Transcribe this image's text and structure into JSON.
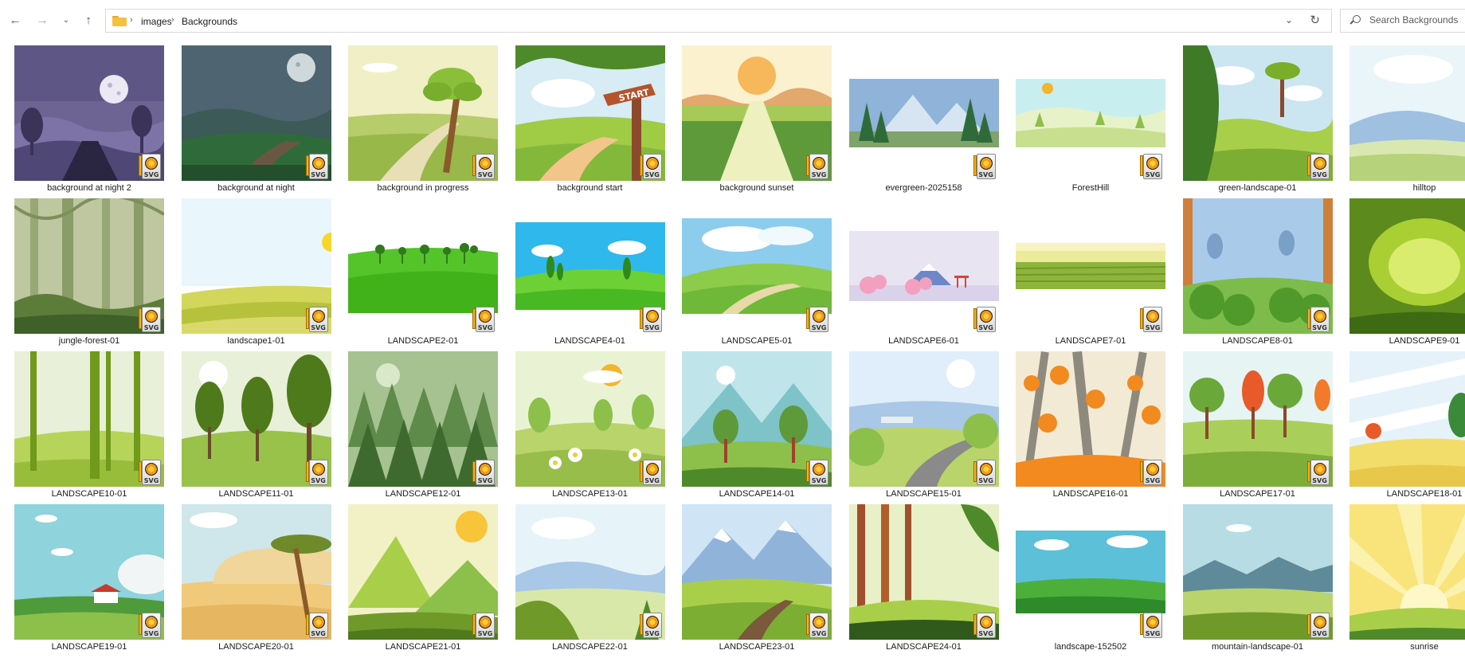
{
  "nav": {
    "back_icon": "arrow-left-icon",
    "forward_icon": "arrow-right-icon",
    "recent_icon": "chevron-down-icon",
    "up_icon": "arrow-up-icon"
  },
  "address": {
    "crumbs": [
      "images",
      "Backgrounds"
    ],
    "folder_icon": "folder-icon"
  },
  "search": {
    "placeholder": "Search Backgrounds"
  },
  "colors": {
    "folder": "#f6c03f",
    "svg_badge_orange": "#f39a13"
  },
  "files": [
    {
      "name": "background at night 2",
      "theme": "night2"
    },
    {
      "name": "background at night",
      "theme": "night"
    },
    {
      "name": "background in progress",
      "theme": "progress"
    },
    {
      "name": "background start",
      "theme": "start"
    },
    {
      "name": "background sunset",
      "theme": "sunset"
    },
    {
      "name": "evergreen-2025158",
      "theme": "evergreen"
    },
    {
      "name": "ForestHill",
      "theme": "foresthill"
    },
    {
      "name": "green-landscape-01",
      "theme": "greenland"
    },
    {
      "name": "hilltop",
      "theme": "hilltop"
    },
    {
      "name": "jungle-forest-01",
      "theme": "jungle"
    },
    {
      "name": "landscape1-01",
      "theme": "ls1"
    },
    {
      "name": "LANDSCAPE2-01",
      "theme": "ls2"
    },
    {
      "name": "LANDSCAPE4-01",
      "theme": "ls4"
    },
    {
      "name": "LANDSCAPE5-01",
      "theme": "ls5"
    },
    {
      "name": "LANDSCAPE6-01",
      "theme": "ls6"
    },
    {
      "name": "LANDSCAPE7-01",
      "theme": "ls7"
    },
    {
      "name": "LANDSCAPE8-01",
      "theme": "ls8"
    },
    {
      "name": "LANDSCAPE9-01",
      "theme": "ls9"
    },
    {
      "name": "LANDSCAPE10-01",
      "theme": "ls10"
    },
    {
      "name": "LANDSCAPE11-01",
      "theme": "ls11"
    },
    {
      "name": "LANDSCAPE12-01",
      "theme": "ls12"
    },
    {
      "name": "LANDSCAPE13-01",
      "theme": "ls13"
    },
    {
      "name": "LANDSCAPE14-01",
      "theme": "ls14"
    },
    {
      "name": "LANDSCAPE15-01",
      "theme": "ls15"
    },
    {
      "name": "LANDSCAPE16-01",
      "theme": "ls16"
    },
    {
      "name": "LANDSCAPE17-01",
      "theme": "ls17"
    },
    {
      "name": "LANDSCAPE18-01",
      "theme": "ls18"
    },
    {
      "name": "LANDSCAPE19-01",
      "theme": "ls19"
    },
    {
      "name": "LANDSCAPE20-01",
      "theme": "ls20"
    },
    {
      "name": "LANDSCAPE21-01",
      "theme": "ls21"
    },
    {
      "name": "LANDSCAPE22-01",
      "theme": "ls22"
    },
    {
      "name": "LANDSCAPE23-01",
      "theme": "ls23"
    },
    {
      "name": "LANDSCAPE24-01",
      "theme": "ls24"
    },
    {
      "name": "landscape-152502",
      "theme": "ls152502"
    },
    {
      "name": "mountain-landscape-01",
      "theme": "mountain"
    },
    {
      "name": "sunrise",
      "theme": "sunrise"
    }
  ],
  "badge": {
    "label": "SVG",
    "icon": "svg-file-badge-icon"
  }
}
